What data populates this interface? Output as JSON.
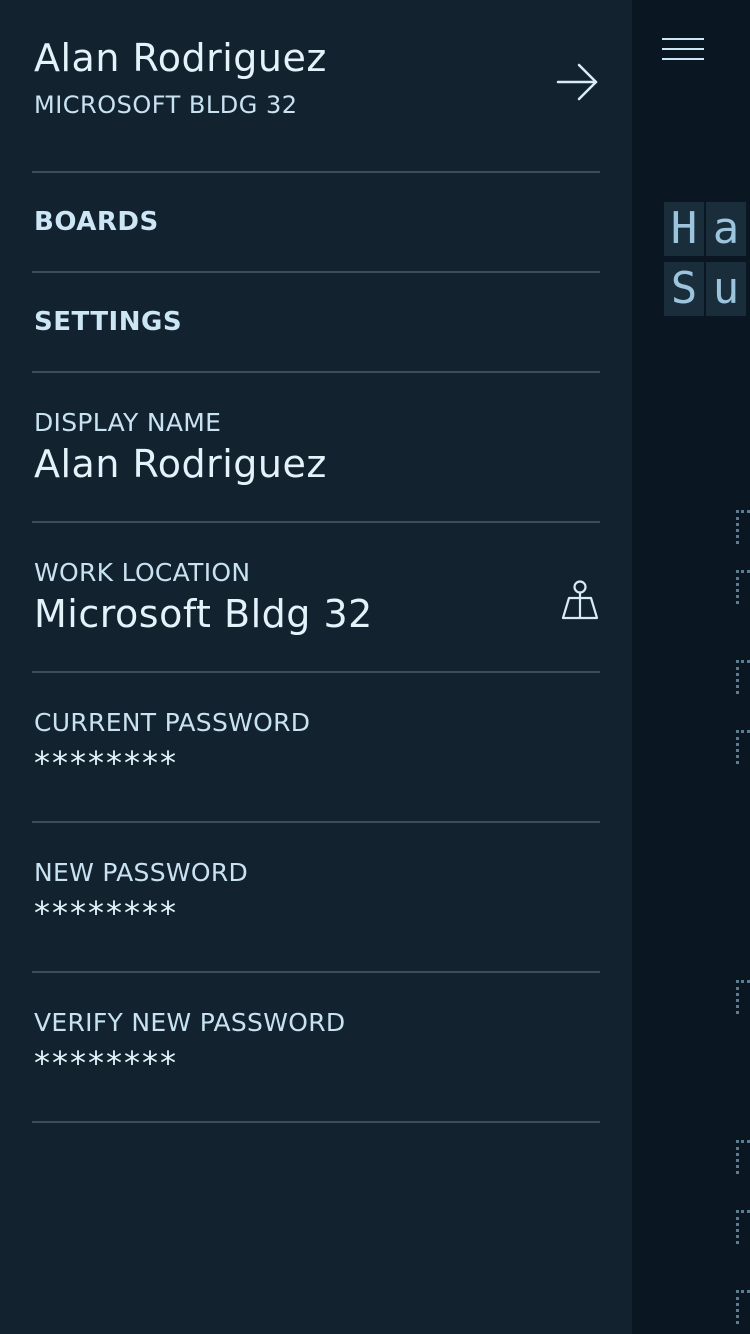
{
  "drawer": {
    "user": {
      "name": "Alan Rodriguez",
      "location": "MICROSOFT BLDG 32"
    },
    "nav": {
      "boards": "BOARDS",
      "settings": "SETTINGS"
    },
    "fields": {
      "display_name": {
        "label": "DISPLAY NAME",
        "value": "Alan Rodriguez"
      },
      "work_location": {
        "label": "WORK LOCATION",
        "value": "Microsoft Bldg 32"
      },
      "current_password": {
        "label": "CURRENT PASSWORD",
        "value": "********"
      },
      "new_password": {
        "label": "NEW PASSWORD",
        "value": "********"
      },
      "verify_new_password": {
        "label": "VERIFY NEW PASSWORD",
        "value": "********"
      }
    }
  },
  "main": {
    "board_tiles": [
      "H",
      "a",
      "S",
      "u"
    ]
  },
  "icons": {
    "logout": "arrow-right-icon",
    "location": "map-pin-icon",
    "menu": "hamburger-menu-icon"
  },
  "colors": {
    "drawer_bg": "#12222f",
    "main_bg": "#0a1722",
    "text": "#e4f2fa",
    "divider": "#3d4e5b"
  }
}
